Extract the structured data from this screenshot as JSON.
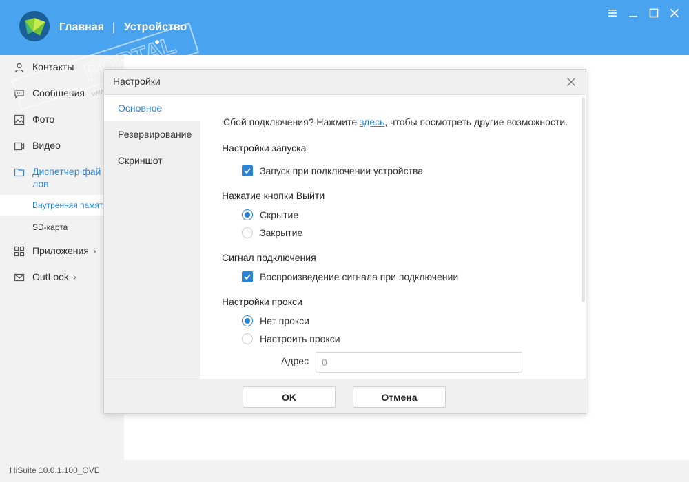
{
  "header": {
    "nav_home": "Главная",
    "nav_device": "Устройство",
    "logo_icon": "hisuite-logo-icon",
    "window_controls": [
      "menu-icon",
      "minimize-icon",
      "maximize-icon",
      "close-icon"
    ]
  },
  "sidebar": {
    "items": [
      {
        "label": "Контакты",
        "icon": "contacts-icon"
      },
      {
        "label": "Сообщения",
        "icon": "messages-icon"
      },
      {
        "label": "Фото",
        "icon": "photo-icon"
      },
      {
        "label": "Видео",
        "icon": "video-icon"
      },
      {
        "label": "Диспетчер фай",
        "label2": "лов",
        "icon": "folder-icon"
      },
      {
        "label": "Приложения",
        "icon": "apps-icon"
      },
      {
        "label": "OutLook",
        "icon": "mail-icon"
      }
    ],
    "subitems": [
      {
        "label": "Внутренняя памят"
      },
      {
        "label": "SD-карта"
      }
    ]
  },
  "status": {
    "version": "HiSuite 10.0.1.100_OVE"
  },
  "watermark": {
    "brand": "PORTAL",
    "url": "www.softportal.com",
    "tm": "™"
  },
  "dialog": {
    "title": "Настройки",
    "tabs": [
      "Основное",
      "Резервирование",
      "Скриншот"
    ],
    "hint_before": "Сбой подключения? Нажмите ",
    "hint_link": "здесь",
    "hint_after": ", чтобы посмотреть другие возможности.",
    "launch": {
      "heading": "Настройки запуска",
      "option": "Запуск при подключении устройства"
    },
    "exit": {
      "heading": "Нажатие кнопки Выйти",
      "options": [
        "Скрытие",
        "Закрытие"
      ]
    },
    "signal": {
      "heading": "Сигнал подключения",
      "option": "Воспроизведение сигнала при подключении"
    },
    "proxy": {
      "heading": "Настройки прокси",
      "options": [
        "Нет прокси",
        "Настроить прокси"
      ],
      "address_label": "Адрес",
      "address_value": "0"
    },
    "ok_label": "OK",
    "cancel_label": "Отмена"
  },
  "colors": {
    "header": "#4aa3ee",
    "accent": "#2a84d6"
  }
}
